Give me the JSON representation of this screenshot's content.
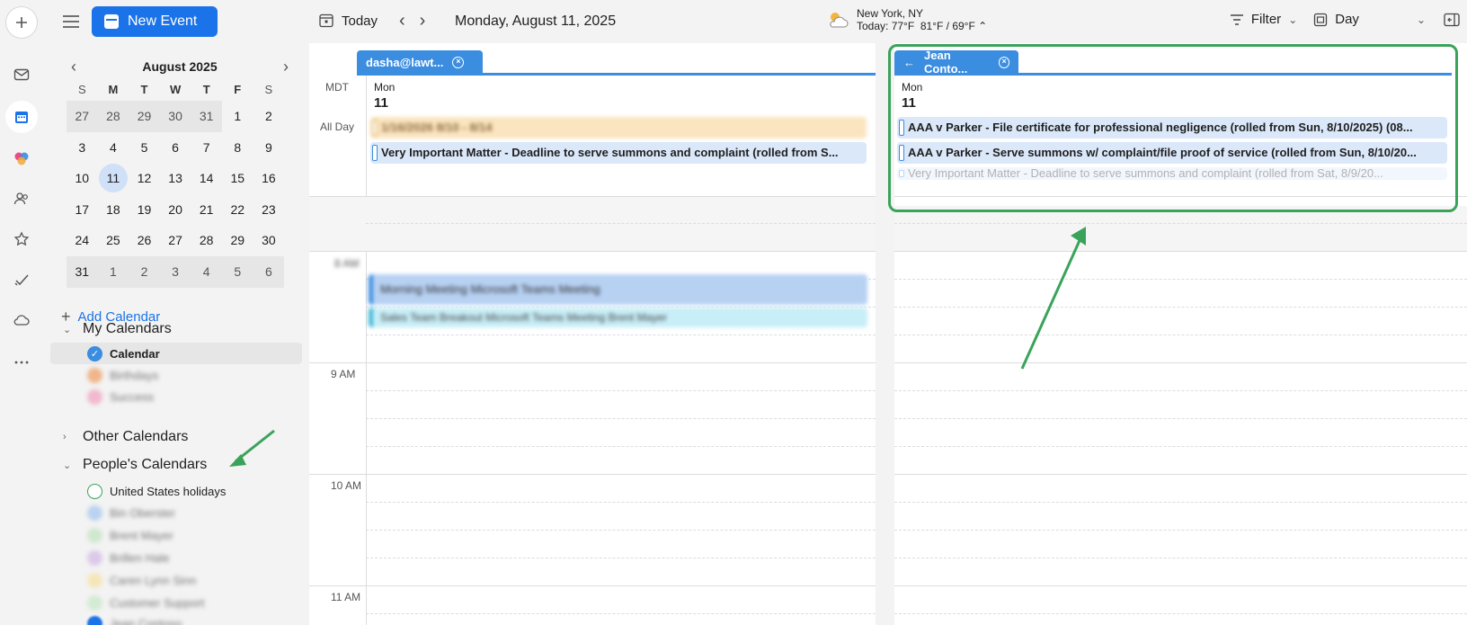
{
  "sidebar": {
    "new_event_label": "New Event",
    "mini_calendar": {
      "title": "August 2025",
      "weekdays": [
        "S",
        "M",
        "T",
        "W",
        "T",
        "F",
        "S"
      ],
      "weeks": [
        [
          "27",
          "28",
          "29",
          "30",
          "31",
          "1",
          "2"
        ],
        [
          "3",
          "4",
          "5",
          "6",
          "7",
          "8",
          "9"
        ],
        [
          "10",
          "11",
          "12",
          "13",
          "14",
          "15",
          "16"
        ],
        [
          "17",
          "18",
          "19",
          "20",
          "21",
          "22",
          "23"
        ],
        [
          "24",
          "25",
          "26",
          "27",
          "28",
          "29",
          "30"
        ],
        [
          "31",
          "1",
          "2",
          "3",
          "4",
          "5",
          "6"
        ]
      ]
    },
    "add_calendar_label": "Add Calendar",
    "my_calendars_label": "My Calendars",
    "calendar_item": "Calendar",
    "birthdays_item": "Birthdays",
    "success_item": "Success",
    "other_calendars_label": "Other Calendars",
    "peoples_calendars_label": "People's Calendars",
    "us_holidays_item": "United States holidays",
    "blurred_items": [
      "Bin Oberster",
      "Brent Mayer",
      "Brillen Hale",
      "Caren Lynn Sinn",
      "Customer Support"
    ],
    "jean_item": "Jean Contoso"
  },
  "toolbar": {
    "today_label": "Today",
    "date_label": "Monday, August 11, 2025",
    "weather_city": "New York, NY",
    "weather_today": "Today: 77°F",
    "weather_range": "81°F / 69°F",
    "filter_label": "Filter",
    "view_label": "Day"
  },
  "left_pane": {
    "tab_label": "dasha@lawt...",
    "timezone": "MDT",
    "all_day_label": "All Day",
    "day_name": "Mon",
    "day_num": "11",
    "all_day_events": [
      "1/16/2026 8/10 - 8/14",
      "Very Important Matter - Deadline to serve summons and complaint  (rolled from S..."
    ],
    "hour_labels": [
      "8 AM",
      "9 AM",
      "10 AM",
      "11 AM"
    ],
    "timed_events": [
      "Morning Meeting Microsoft Teams Meeting",
      "Sales Team Breakout Microsoft Teams Meeting Brent Mayer"
    ]
  },
  "right_pane": {
    "tab_label": "Jean Conto...",
    "day_name": "Mon",
    "day_num": "11",
    "all_day_events": [
      "AAA v Parker - File certificate for professional negligence  (rolled from Sun, 8/10/2025)  (08...",
      "AAA v Parker - Serve summons w/ complaint/file proof of service  (rolled from Sun, 8/10/20...",
      "Very Important Matter - Deadline to serve summons and complaint  (rolled from Sat, 8/9/20..."
    ]
  },
  "colors": {
    "accent": "#1a73e8",
    "tab": "#3b8de0",
    "annotation": "#3aa35a"
  }
}
